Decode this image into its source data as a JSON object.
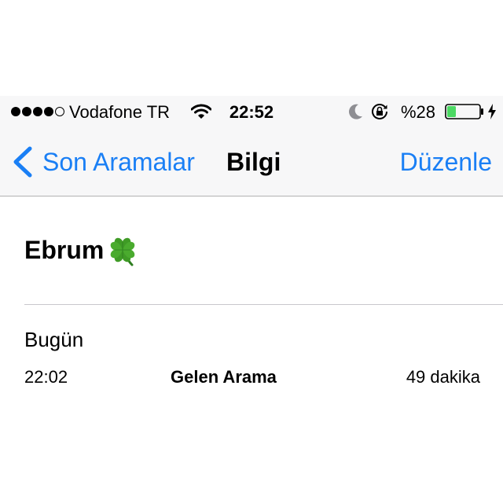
{
  "status_bar": {
    "carrier": "Vodafone TR",
    "time": "22:52",
    "battery_percent": "%28",
    "battery_level": 0.28,
    "signal_bars": 4,
    "signal_max": 5,
    "icons": [
      "wifi-icon",
      "moon-icon",
      "rotation-lock-icon",
      "battery-icon",
      "charging-bolt-icon"
    ]
  },
  "nav": {
    "back_label": "Son Aramalar",
    "title": "Bilgi",
    "edit_label": "Düzenle"
  },
  "contact": {
    "name": "Ebrum",
    "emoji": "four-leaf-clover"
  },
  "calls": {
    "day": "Bugün",
    "items": [
      {
        "time": "22:02",
        "type": "Gelen Arama",
        "duration": "49 dakika"
      }
    ]
  },
  "colors": {
    "accent": "#1a7ff5",
    "battery_fill": "#4cd964",
    "bar_background": "#f7f7f8",
    "separator": "#c8c7cc"
  }
}
